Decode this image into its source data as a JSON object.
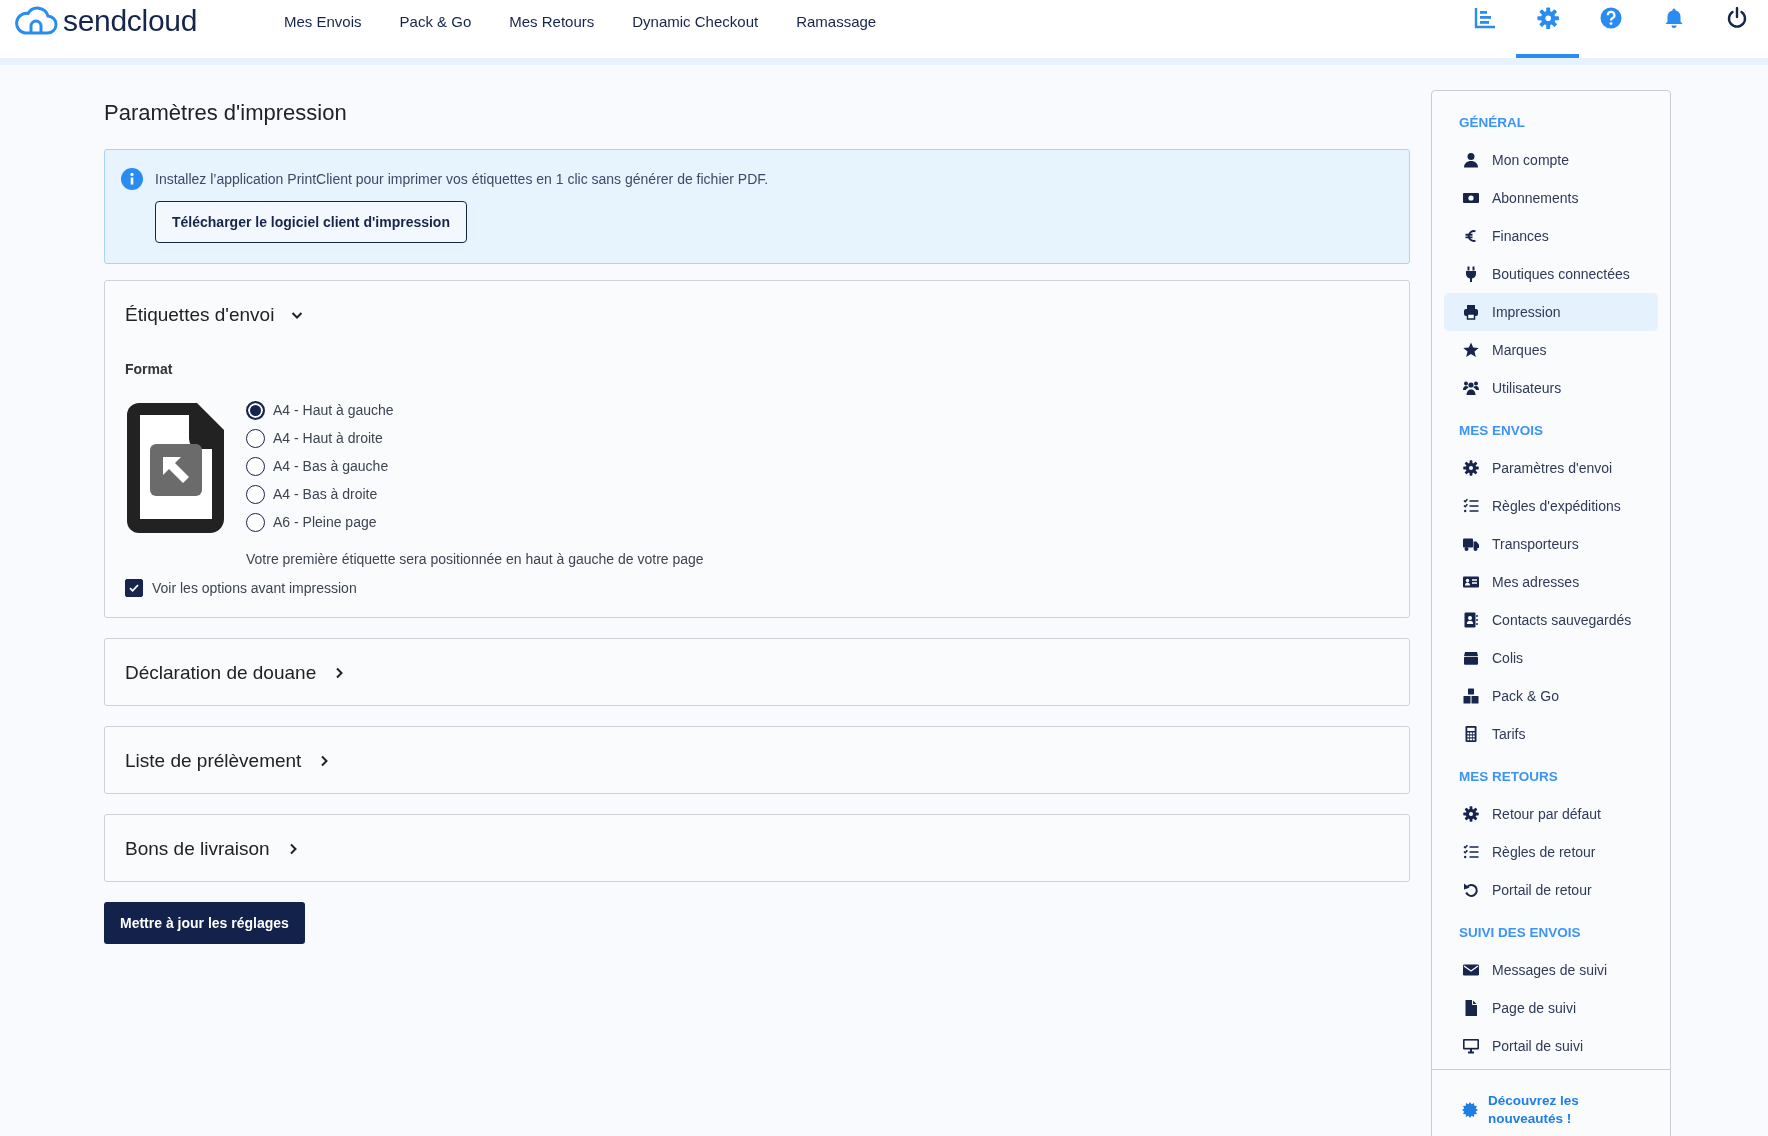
{
  "header": {
    "brand": "sendcloud",
    "nav": [
      "Mes Envois",
      "Pack & Go",
      "Mes Retours",
      "Dynamic Checkout",
      "Ramassage"
    ],
    "toolbar": [
      {
        "selected": false
      },
      {
        "selected": true
      },
      {
        "selected": false
      },
      {
        "selected": false
      },
      {
        "selected": false
      }
    ]
  },
  "page": {
    "title": "Paramètres d'impression",
    "notice": {
      "text": "Installez l’application PrintClient pour imprimer vos étiquettes en 1 clic sans générer de fichier PDF.",
      "button": "Télécharger le logiciel client d'impression"
    },
    "sections": [
      {
        "title": "Étiquettes d'envoi",
        "expanded": true,
        "format_label": "Format",
        "options": [
          {
            "label": "A4 - Haut à gauche",
            "selected": true
          },
          {
            "label": "A4 - Haut à droite",
            "selected": false
          },
          {
            "label": "A4 - Bas à gauche",
            "selected": false
          },
          {
            "label": "A4 - Bas à droite",
            "selected": false
          },
          {
            "label": "A6 - Pleine page",
            "selected": false
          }
        ],
        "hint": "Votre première étiquette sera positionnée en haut à gauche de votre page",
        "preview": {
          "label": "Voir les options avant impression",
          "checked": true
        }
      },
      {
        "title": "Déclaration de douane",
        "expanded": false
      },
      {
        "title": "Liste de prélèvement",
        "expanded": false
      },
      {
        "title": "Bons de livraison",
        "expanded": false
      }
    ],
    "submit": "Mettre à jour les réglages"
  },
  "sidebar": {
    "groups": [
      {
        "heading": "GÉNÉRAL",
        "items": [
          {
            "label": "Mon compte",
            "selected": false
          },
          {
            "label": "Abonnements",
            "selected": false
          },
          {
            "label": "Finances",
            "selected": false
          },
          {
            "label": "Boutiques connectées",
            "selected": false
          },
          {
            "label": "Impression",
            "selected": true
          },
          {
            "label": "Marques",
            "selected": false
          },
          {
            "label": "Utilisateurs",
            "selected": false
          }
        ]
      },
      {
        "heading": "MES ENVOIS",
        "items": [
          {
            "label": "Paramètres d'envoi",
            "selected": false
          },
          {
            "label": "Règles d'expéditions",
            "selected": false
          },
          {
            "label": "Transporteurs",
            "selected": false
          },
          {
            "label": "Mes adresses",
            "selected": false
          },
          {
            "label": "Contacts sauvegardés",
            "selected": false
          },
          {
            "label": "Colis",
            "selected": false
          },
          {
            "label": "Pack & Go",
            "selected": false
          },
          {
            "label": "Tarifs",
            "selected": false
          }
        ]
      },
      {
        "heading": "MES RETOURS",
        "items": [
          {
            "label": "Retour par défaut",
            "selected": false
          },
          {
            "label": "Règles de retour",
            "selected": false
          },
          {
            "label": "Portail de retour",
            "selected": false
          }
        ]
      },
      {
        "heading": "SUIVI DES ENVOIS",
        "items": [
          {
            "label": "Messages de suivi",
            "selected": false
          },
          {
            "label": "Page de suivi",
            "selected": false
          },
          {
            "label": "Portail de suivi",
            "selected": false
          }
        ]
      }
    ],
    "footer": "Découvrez les nouveautés !"
  }
}
